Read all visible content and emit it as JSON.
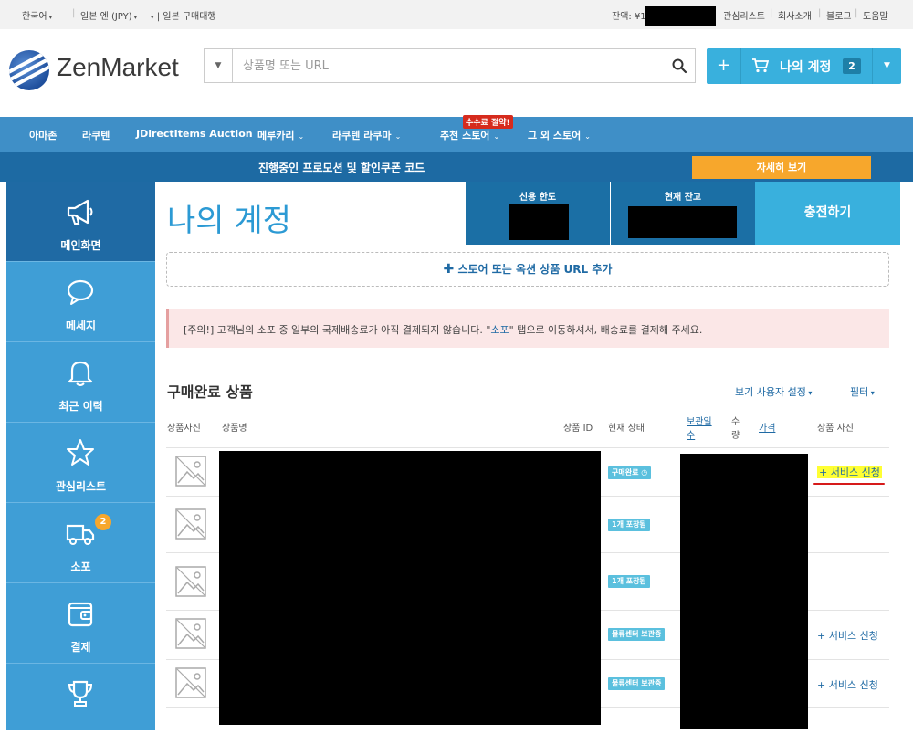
{
  "topbar": {
    "language": "한국어",
    "currency": "일본 엔 (JPY)",
    "service": "일본 구매대행",
    "balance_label": "잔액: ¥1",
    "links": [
      "관심리스트",
      "회사소개",
      "블로그",
      "도움말"
    ]
  },
  "header": {
    "logo_text": "ZenMarket",
    "search_placeholder": "상품명 또는 URL",
    "account_plus": "+",
    "account_label": "나의 계정",
    "cart_count": "2"
  },
  "nav": {
    "items": [
      "아마존",
      "라쿠텐",
      "JDirectItems Auction",
      "메루카리",
      "라쿠텐 라쿠마",
      "추천 스토어",
      "그 외 스토어"
    ],
    "fee_badge": "수수료 절약!"
  },
  "promo": {
    "text": "진행중인 프로모션 및 할인쿠폰 코드",
    "button": "자세히 보기"
  },
  "sidebar": {
    "items": [
      {
        "label": "메인화면",
        "icon": "megaphone-icon"
      },
      {
        "label": "메세지",
        "icon": "speech-bubble-icon"
      },
      {
        "label": "최근 이력",
        "icon": "bell-icon"
      },
      {
        "label": "관심리스트",
        "icon": "star-icon"
      },
      {
        "label": "소포",
        "icon": "truck-icon",
        "badge": "2"
      },
      {
        "label": "결제",
        "icon": "wallet-icon"
      },
      {
        "label": "",
        "icon": "trophy-icon"
      }
    ]
  },
  "main": {
    "title": "나의 계정",
    "credit_label": "신용 한도",
    "balance_label": "현재 잔고",
    "charge_button": "충전하기",
    "add_url": "스토어 또는 옥션 상품 URL 추가",
    "notice_prefix": "[주의!] 고객님의 소포 중 일부의 국제배송료가 아직 결제되지 않습니다. \"",
    "notice_link": "소포",
    "notice_suffix": "\" 탭으로 이동하셔서, 배송료를 결제해 주세요.",
    "section_title": "구매완료 상품",
    "view_settings": "보기 사용자 설정",
    "filter": "필터",
    "columns": {
      "photo": "상품사진",
      "name": "상품명",
      "id": "상품 ID",
      "status": "현재 상태",
      "storage_1": "보관일",
      "storage_2": "수",
      "qty_1": "수",
      "qty_2": "량",
      "price": "가격",
      "service": "상품 사진"
    },
    "rows": [
      {
        "status": "구매완료",
        "service": "+ 서비스 신청"
      },
      {
        "status": "1개 포장됨",
        "service": ""
      },
      {
        "status": "1개 포장됨",
        "service": ""
      },
      {
        "status": "물류센터 보관중",
        "service": "+ 서비스 신청"
      },
      {
        "status": "물류센터 보관중",
        "service": "+ 서비스 신청"
      }
    ]
  },
  "colors": {
    "nav": "#3f8fc7",
    "promo": "#1d6aa3",
    "sidebar": "#3f9ed6",
    "accent": "#39b0dd",
    "promo_button": "#f7a72c",
    "status_badge": "#5bc0de"
  }
}
